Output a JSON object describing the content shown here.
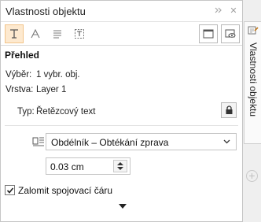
{
  "panel": {
    "title": "Vlastnosti objektu",
    "controls": {
      "pin_icon": "double-chevron-right-icon",
      "close_glyph": "✕"
    }
  },
  "tabs": [
    {
      "icon": "character-icon",
      "active": true
    },
    {
      "icon": "artistic-text-icon",
      "active": false
    },
    {
      "icon": "paragraph-icon",
      "active": false
    },
    {
      "icon": "frame-text-icon",
      "active": false
    }
  ],
  "section": {
    "title": "Přehled",
    "selection_label": "Výběr:",
    "selection_value": "1 vybr. obj.",
    "layer_label": "Vrstva:",
    "layer_value": "Layer 1",
    "type_label": "Typ:",
    "type_value": "Řetězcový text"
  },
  "wrap": {
    "selected": "Obdélník – Obtékání zprava",
    "offset": "0.03 cm"
  },
  "checkbox": {
    "label": "Zalomit spojovací čáru",
    "checked": true
  },
  "side_panel": {
    "tab_label": "Vlastnosti objektu"
  },
  "colors": {
    "accent_bg": "#fde9cf",
    "accent_border": "#f2c489"
  }
}
